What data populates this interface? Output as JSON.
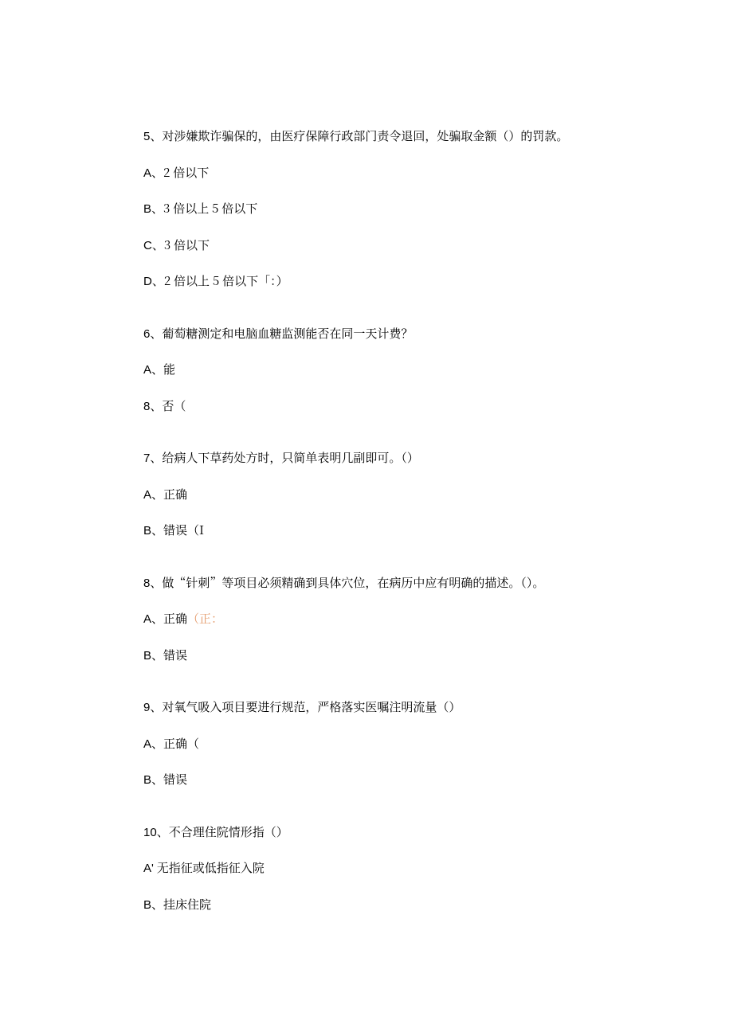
{
  "questions": [
    {
      "q_label": "5",
      "q_text": "、对涉嫌欺诈骗保的，由医疗保障行政部门责令退回，处骗取金额（）的罚款。",
      "options": [
        {
          "label": "A",
          "text": "、2 倍以下",
          "ans": ""
        },
        {
          "label": "B",
          "text": "、3 倍以上 5 倍以下",
          "ans": ""
        },
        {
          "label": "C",
          "text": "、3 倍以下",
          "ans": ""
        },
        {
          "label": "D",
          "text": "、2 倍以上 5 倍以下「：）",
          "ans": ""
        }
      ]
    },
    {
      "q_label": "6",
      "q_text": "、葡萄糖测定和电脑血糖监测能否在同一天计费？",
      "options": [
        {
          "label": "A",
          "text": "、能",
          "ans": ""
        },
        {
          "label": "8",
          "text": "、否（",
          "ans": ""
        }
      ]
    },
    {
      "q_label": "7",
      "q_text": "、给病人下草药处方时，只简单表明几副即可。（）",
      "options": [
        {
          "label": "A",
          "text": "、正确",
          "ans": ""
        },
        {
          "label": "B",
          "text": "、错误（I",
          "ans": ""
        }
      ]
    },
    {
      "q_label": "8",
      "q_text": "、做“针刺”等项目必须精确到具体穴位，在病历中应有明确的描述。（）。",
      "options": [
        {
          "label": "A",
          "text": "、正确",
          "ans": "（正："
        },
        {
          "label": "B",
          "text": "、错误",
          "ans": ""
        }
      ]
    },
    {
      "q_label": "9",
      "q_text": "、对氧气吸入项目要进行规范，严格落实医嘱注明流量（）",
      "options": [
        {
          "label": "A",
          "text": "、正确（",
          "ans": ""
        },
        {
          "label": "B",
          "text": "、错误",
          "ans": ""
        }
      ]
    },
    {
      "q_label": "10",
      "q_text": "、不合理住院情形指（）",
      "options": [
        {
          "label": "A'",
          "text": " 无指征或低指征入院",
          "ans": ""
        },
        {
          "label": "B",
          "text": "、挂床住院",
          "ans": ""
        }
      ]
    }
  ]
}
